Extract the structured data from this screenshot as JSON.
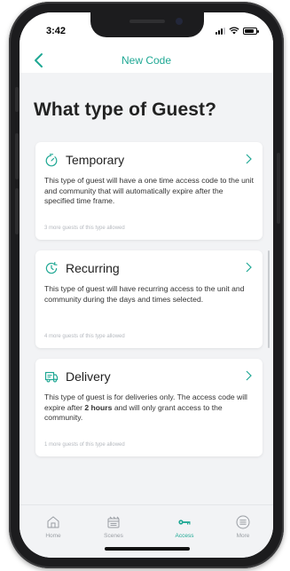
{
  "status_bar": {
    "time": "3:42"
  },
  "header": {
    "title": "New Code"
  },
  "page": {
    "title": "What type of Guest?"
  },
  "guest_types": [
    {
      "title": "Temporary",
      "description": "This type of guest will have a one time access code to the unit and community that will automatically expire after the specified time frame.",
      "note": "3 more guests of this type allowed",
      "icon": "stopwatch-icon"
    },
    {
      "title": "Recurring",
      "description": "This type of guest will have recurring access to the unit and community during the days and times selected.",
      "note": "4 more guests of this type allowed",
      "icon": "recurring-clock-icon"
    },
    {
      "title": "Delivery",
      "description_before": "This type of guest is for deliveries only. The access code will expire after ",
      "description_bold": "2 hours",
      "description_after": " and will only grant access to the community.",
      "note": "1 more guests of this type allowed",
      "icon": "delivery-truck-icon"
    }
  ],
  "tab_bar": {
    "items": [
      {
        "label": "Home",
        "icon": "home-icon",
        "active": false
      },
      {
        "label": "Scenes",
        "icon": "scenes-icon",
        "active": false
      },
      {
        "label": "Access",
        "icon": "key-icon",
        "active": true
      },
      {
        "label": "More",
        "icon": "menu-icon",
        "active": false
      }
    ]
  },
  "colors": {
    "accent": "#1fa894",
    "background": "#f2f3f5",
    "card": "#ffffff",
    "muted": "#9a9ea4"
  }
}
